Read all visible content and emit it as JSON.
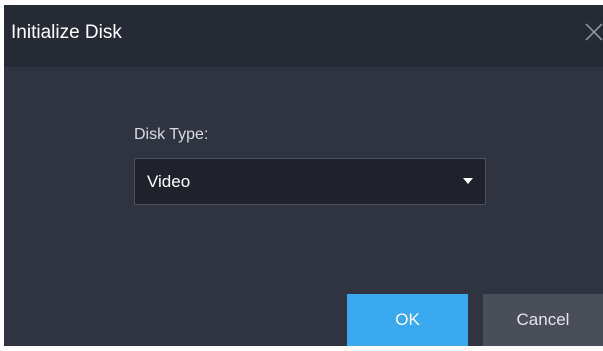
{
  "dialog": {
    "title": "Initialize Disk",
    "close_icon": "close-icon"
  },
  "form": {
    "disk_type_label": "Disk Type:",
    "disk_type_value": "Video",
    "dropdown_icon": "caret-down-icon"
  },
  "actions": {
    "ok_label": "OK",
    "cancel_label": "Cancel"
  },
  "colors": {
    "dialog_bg": "#303440",
    "titlebar_bg": "#262a34",
    "select_bg": "#1f222a",
    "primary_button": "#3aa8f0",
    "secondary_button": "#4a4e59"
  }
}
